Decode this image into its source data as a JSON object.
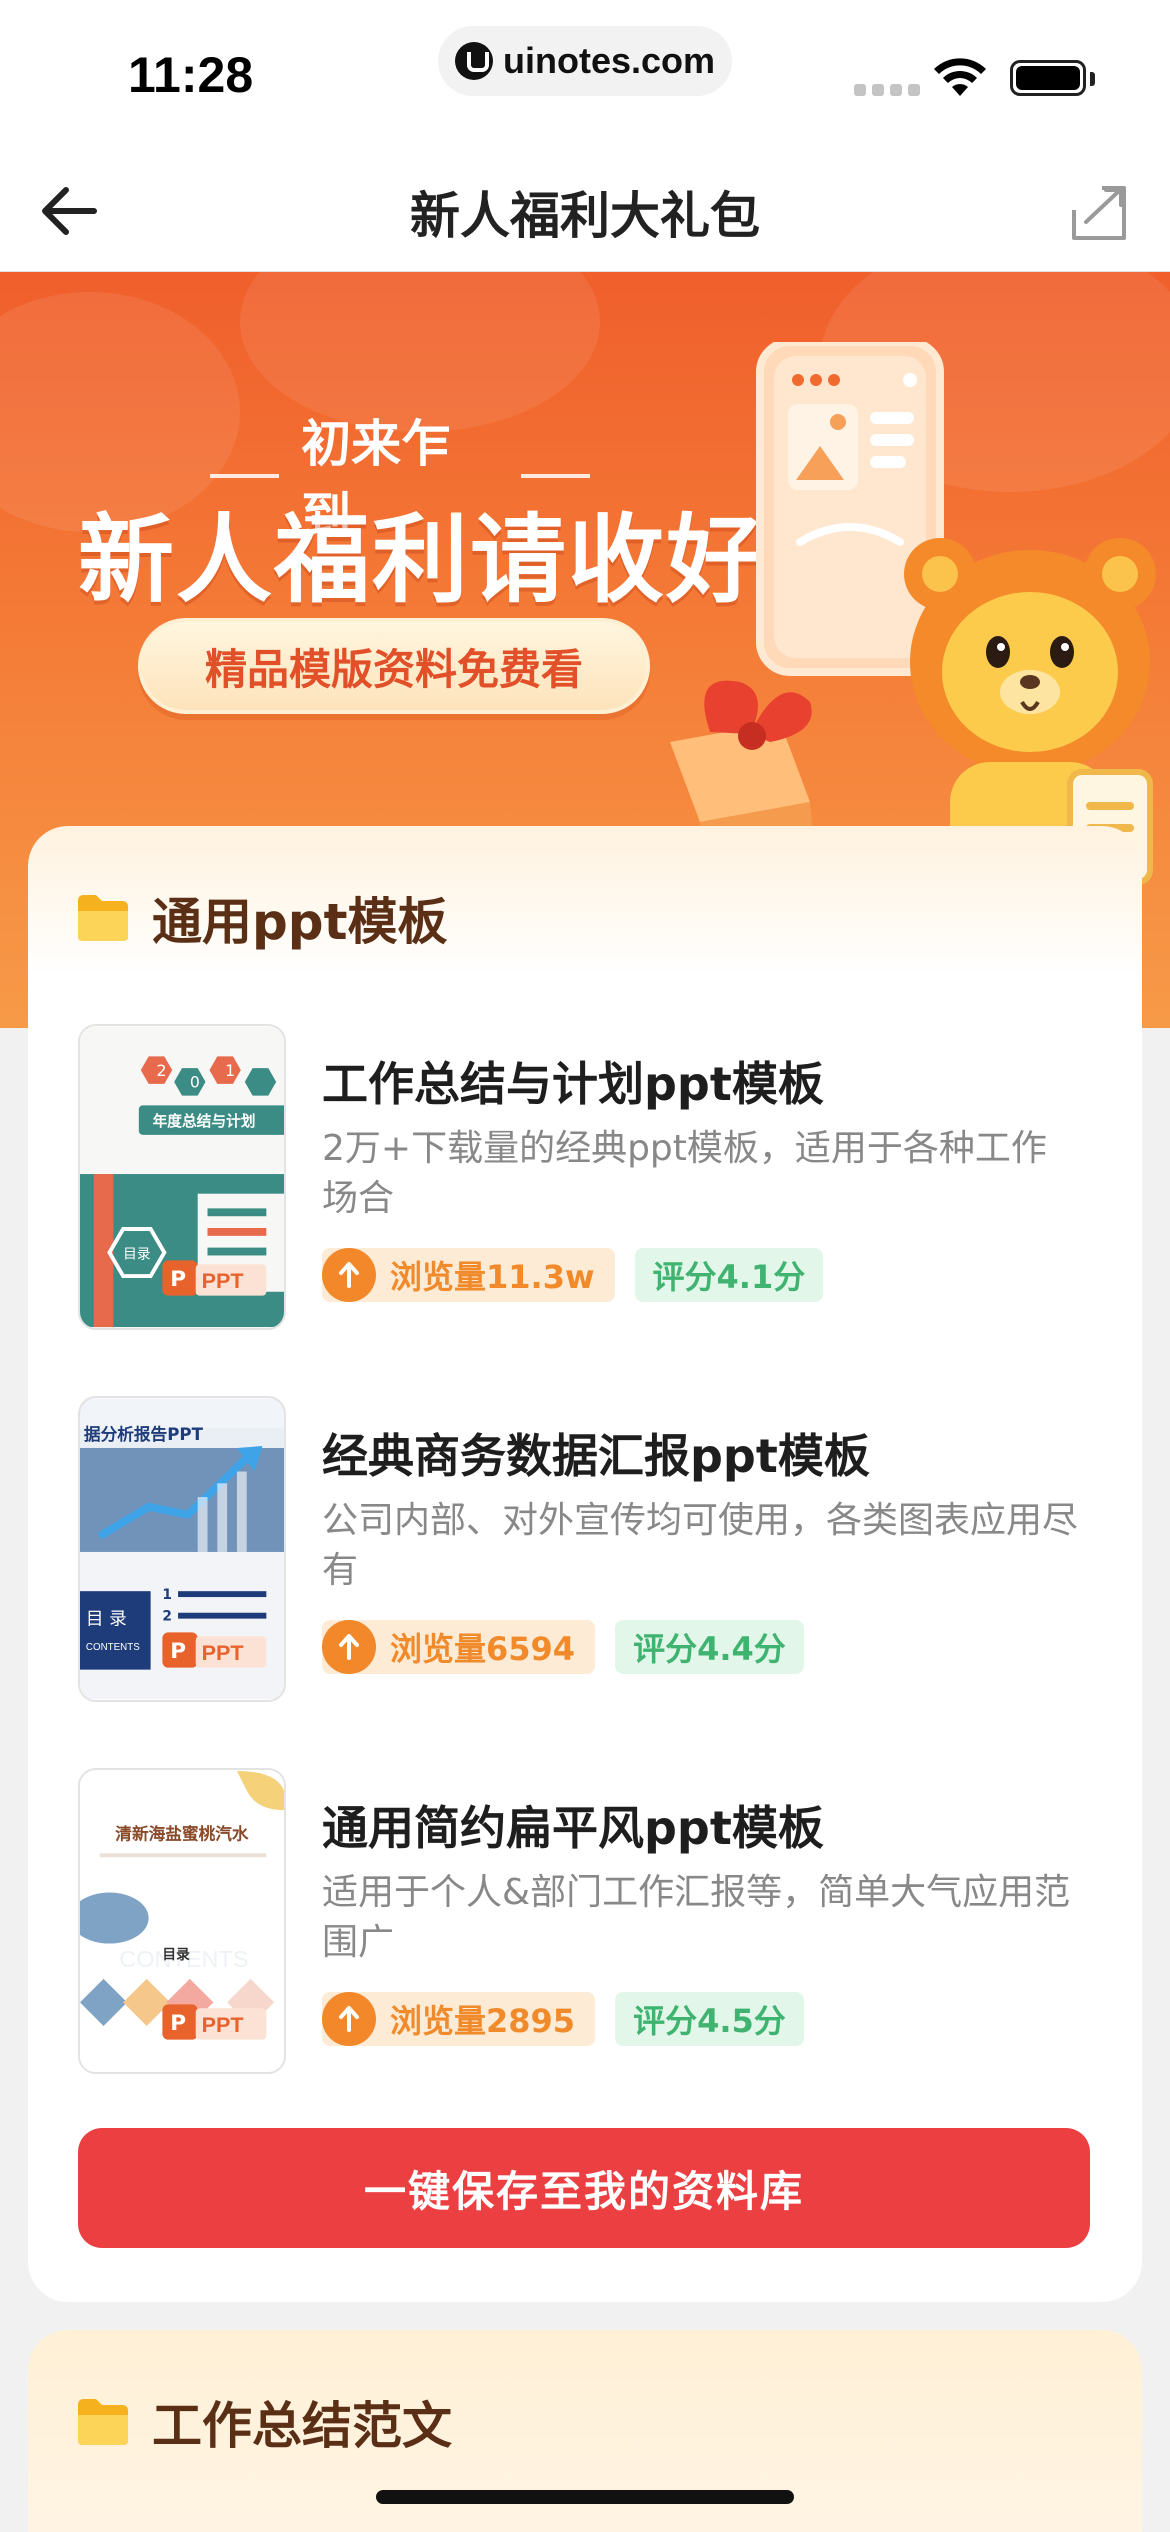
{
  "status_bar": {
    "time": "11:28",
    "url": "uinotes.com"
  },
  "nav": {
    "title": "新人福利大礼包"
  },
  "banner": {
    "subtitle": "初来乍到",
    "title": "新人福利请收好",
    "pill": "精品模版资料免费看"
  },
  "section1": {
    "title": "通用ppt模板",
    "items": [
      {
        "title": "工作总结与计划ppt模板",
        "desc": "2万+下载量的经典ppt模板，适用于各种工作场合",
        "views": "浏览量11.3w",
        "score": "评分4.1分",
        "thumb_heading": "年度总结与计划",
        "thumb_toc": "目录",
        "thumb_badge": "PPT"
      },
      {
        "title": "经典商务数据汇报ppt模板",
        "desc": "公司内部、对外宣传均可使用，各类图表应用尽有",
        "views": "浏览量6594",
        "score": "评分4.4分",
        "thumb_heading": "据分析报告PPT",
        "thumb_toc": "目 录",
        "thumb_badge": "PPT"
      },
      {
        "title": "通用简约扁平风ppt模板",
        "desc": "适用于个人&部门工作汇报等，简单大气应用范围广",
        "views": "浏览量2895",
        "score": "评分4.5分",
        "thumb_heading": "清新海盐蜜桃汽水",
        "thumb_toc": "目录",
        "thumb_badge": "PPT"
      }
    ],
    "save_button": "一键保存至我的资料库"
  },
  "section2": {
    "title": "工作总结范文"
  },
  "colors": {
    "accent_red": "#ec3f42",
    "banner_orange": "#f05f2c",
    "views_orange": "#f08a2a",
    "score_green": "#3fb36f"
  }
}
